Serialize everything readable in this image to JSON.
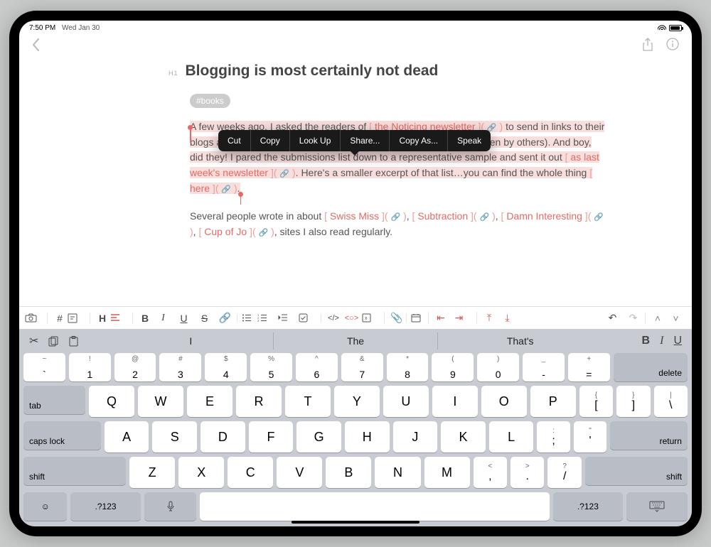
{
  "status": {
    "time": "7:50 PM",
    "date": "Wed Jan 30"
  },
  "doc": {
    "h1_label": "H1",
    "title": "Blogging is most certainly not dead",
    "tag": "#books"
  },
  "contextmenu": [
    "Cut",
    "Copy",
    "Look Up",
    "Share...",
    "Copy As...",
    "Speak"
  ],
  "p1": {
    "a": "A few weeks ago, I asked the readers of ",
    "link1": "the Noticing newsletter",
    "b": " to send in links to their blogs and newsletters (or to their favorite blogs and newsletters written by others). And boy, did they! I pared the submissions list down to a representative sample and sent it out ",
    "link2": "as last week's newsletter",
    "c": ". Here's a smaller excerpt of that list…you can find the whole thing ",
    "link3": "here",
    "d": "."
  },
  "p2": {
    "a": "Several people wrote in about ",
    "l1": "Swiss Miss",
    "b": ", ",
    "l2": "Subtraction",
    "c": ", ",
    "l3": "Damn Interesting",
    "d": ", ",
    "l4": "Cup of Jo",
    "e": ", sites I also read regularly."
  },
  "suggestions": [
    "I",
    "The",
    "That's"
  ],
  "fmt": {
    "bold": "B",
    "italic": "I",
    "underline": "U"
  },
  "keys": {
    "row1_top": [
      "~",
      "!",
      "@",
      "#",
      "$",
      "%",
      "^",
      "&",
      "*",
      "(",
      ")",
      "_",
      "+"
    ],
    "row1_bot": [
      "`",
      "1",
      "2",
      "3",
      "4",
      "5",
      "6",
      "7",
      "8",
      "9",
      "0",
      "-",
      "="
    ],
    "row2": [
      "Q",
      "W",
      "E",
      "R",
      "T",
      "Y",
      "U",
      "I",
      "O",
      "P"
    ],
    "row2p_top": [
      "{",
      "}",
      "|"
    ],
    "row2p_bot": [
      "[",
      "]",
      "\\"
    ],
    "row3": [
      "A",
      "S",
      "D",
      "F",
      "G",
      "H",
      "J",
      "K",
      "L"
    ],
    "row3p_top": [
      ":",
      "\""
    ],
    "row3p_bot": [
      ";",
      "'"
    ],
    "row4": [
      "Z",
      "X",
      "C",
      "V",
      "B",
      "N",
      "M"
    ],
    "row4p_top": [
      "<",
      ">",
      "?"
    ],
    "row4p_bot": [
      ",",
      ".",
      "/"
    ],
    "tab": "tab",
    "caps": "caps lock",
    "shift": "shift",
    "return": "return",
    "delete": "delete",
    "numsym": ".?123"
  },
  "linkglyph": "🔗"
}
